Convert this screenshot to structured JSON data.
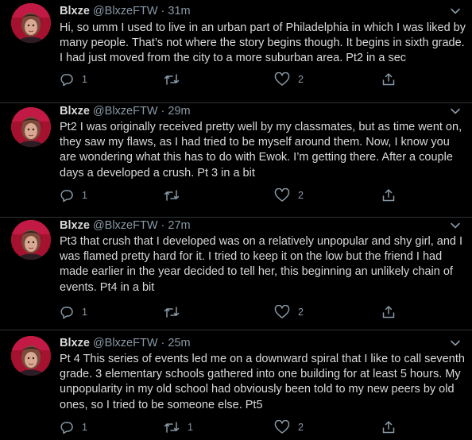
{
  "tweets": [
    {
      "name": "Blxze",
      "handle": "@BlxzeFTW",
      "separator": "·",
      "time": "31m",
      "text": "Hi, so umm I used to live in an urban part of Philadelphia in which I was liked by many people. That’s not where the story begins though. It begins in sixth grade. I had just moved from the city to a more suburban area. Pt2 in a sec",
      "replies": "1",
      "retweets": "",
      "likes": "2"
    },
    {
      "name": "Blxze",
      "handle": "@BlxzeFTW",
      "separator": "·",
      "time": "29m",
      "text": "Pt2 I was originally received pretty well by my classmates, but as time went on, they saw my flaws, as I had tried to be myself around them. Now, I know you are wondering what this has to do with Ewok. I’m getting there. After a couple days a developed a crush. Pt 3 in a bit",
      "replies": "1",
      "retweets": "",
      "likes": "2"
    },
    {
      "name": "Blxze",
      "handle": "@BlxzeFTW",
      "separator": "·",
      "time": "27m",
      "text": "Pt3 that crush that I developed was on a relatively unpopular and shy girl, and I was flamed pretty hard for it. I tried to keep it on the low but the friend I had made earlier in the year decided to tell her, this beginning an unlikely chain of events. Pt4 in a bit",
      "replies": "1",
      "retweets": "",
      "likes": "2"
    },
    {
      "name": "Blxze",
      "handle": "@BlxzeFTW",
      "separator": "·",
      "time": "25m",
      "text": "Pt 4 This series of events led me on a downward spiral that I like to call seventh grade. 3 elementary schools gathered into one building for at least 5 hours. My unpopularity in my old school had obviously been told to my new peers by old ones, so I tried to be someone else. Pt5",
      "replies": "1",
      "retweets": "1",
      "likes": "2"
    }
  ],
  "colors": {
    "background": "#000000",
    "text": "#d9d9d9",
    "muted": "#8899a6",
    "divider": "#2f3336",
    "avatar_bg": "#b0153a"
  },
  "icons": {
    "reply": "reply-icon",
    "retweet": "retweet-icon",
    "like": "heart-icon",
    "share": "share-icon",
    "menu": "chevron-down-icon"
  }
}
